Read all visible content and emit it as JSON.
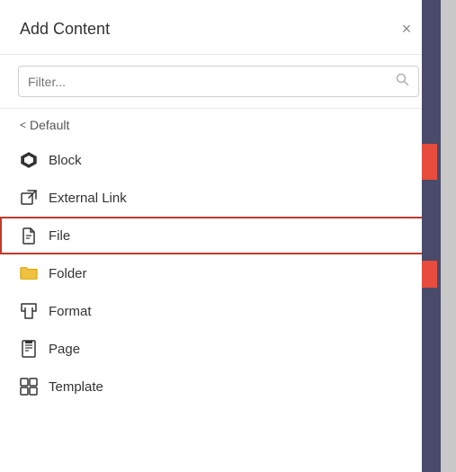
{
  "modal": {
    "title": "Add Content",
    "close_label": "×",
    "search_placeholder": "Filter...",
    "breadcrumb_arrow": "<",
    "breadcrumb_text": "Default"
  },
  "menu_items": [
    {
      "id": "block",
      "label": "Block",
      "icon": "block-icon",
      "active": false
    },
    {
      "id": "external-link",
      "label": "External Link",
      "icon": "external-link-icon",
      "active": false
    },
    {
      "id": "file",
      "label": "File",
      "icon": "file-icon",
      "active": true
    },
    {
      "id": "folder",
      "label": "Folder",
      "icon": "folder-icon",
      "active": false
    },
    {
      "id": "format",
      "label": "Format",
      "icon": "format-icon",
      "active": false
    },
    {
      "id": "page",
      "label": "Page",
      "icon": "page-icon",
      "active": false
    },
    {
      "id": "template",
      "label": "Template",
      "icon": "template-icon",
      "active": false
    }
  ]
}
